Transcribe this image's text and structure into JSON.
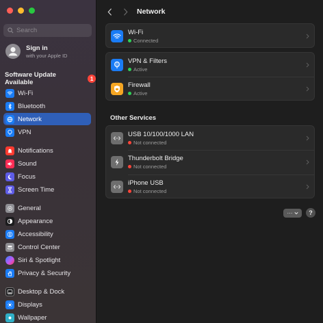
{
  "sidebar": {
    "search_placeholder": "Search",
    "apple_id": {
      "title": "Sign in",
      "subtitle": "with your Apple ID"
    },
    "update": {
      "label": "Software Update Available",
      "badge": "1"
    },
    "items": [
      {
        "label": "Wi-Fi",
        "icon": "wifi-icon",
        "color": "#1a7cf5"
      },
      {
        "label": "Bluetooth",
        "icon": "bluetooth-icon",
        "color": "#1a7cf5"
      },
      {
        "label": "Network",
        "icon": "globe-icon",
        "color": "#1a7cf5"
      },
      {
        "label": "VPN",
        "icon": "vpn-icon",
        "color": "#1a7cf5"
      },
      {
        "label": "Notifications",
        "icon": "bell-icon",
        "color": "#ff3b30"
      },
      {
        "label": "Sound",
        "icon": "speaker-icon",
        "color": "#ff2d55"
      },
      {
        "label": "Focus",
        "icon": "moon-icon",
        "color": "#5e5ce6"
      },
      {
        "label": "Screen Time",
        "icon": "hourglass-icon",
        "color": "#5e5ce6"
      },
      {
        "label": "General",
        "icon": "gear-icon",
        "color": "#8e8e93"
      },
      {
        "label": "Appearance",
        "icon": "appearance-icon",
        "color": "#1c1c1e"
      },
      {
        "label": "Accessibility",
        "icon": "accessibility-icon",
        "color": "#1a7cf5"
      },
      {
        "label": "Control Center",
        "icon": "control-center-icon",
        "color": "#8e8e93"
      },
      {
        "label": "Siri & Spotlight",
        "icon": "siri-icon",
        "color": "#bf5af2"
      },
      {
        "label": "Privacy & Security",
        "icon": "hand-icon",
        "color": "#1a7cf5"
      },
      {
        "label": "Desktop & Dock",
        "icon": "dock-icon",
        "color": "#1c1c1e"
      },
      {
        "label": "Displays",
        "icon": "sun-icon",
        "color": "#1a7cf5"
      },
      {
        "label": "Wallpaper",
        "icon": "wallpaper-icon",
        "color": "#30b0c7"
      }
    ],
    "selected": "Network"
  },
  "header": {
    "title": "Network"
  },
  "services": {
    "wifi": {
      "name": "Wi-Fi",
      "status": "Connected",
      "status_color": "#30d158",
      "icon_color": "#1a7cf5"
    },
    "vpn": {
      "name": "VPN & Filters",
      "status": "Active",
      "status_color": "#30d158",
      "icon_color": "#1a7cf5"
    },
    "firewall": {
      "name": "Firewall",
      "status": "Active",
      "status_color": "#30d158",
      "icon_color": "#f5a623"
    }
  },
  "other_services": {
    "title": "Other Services",
    "items": [
      {
        "name": "USB 10/100/1000 LAN",
        "status": "Not connected",
        "status_color": "#ff453a",
        "icon": "ethernet-icon"
      },
      {
        "name": "Thunderbolt Bridge",
        "status": "Not connected",
        "status_color": "#ff453a",
        "icon": "thunderbolt-icon"
      },
      {
        "name": "iPhone USB",
        "status": "Not connected",
        "status_color": "#ff453a",
        "icon": "ethernet-icon"
      }
    ]
  },
  "footer": {
    "more_label": "···",
    "help_label": "?"
  }
}
